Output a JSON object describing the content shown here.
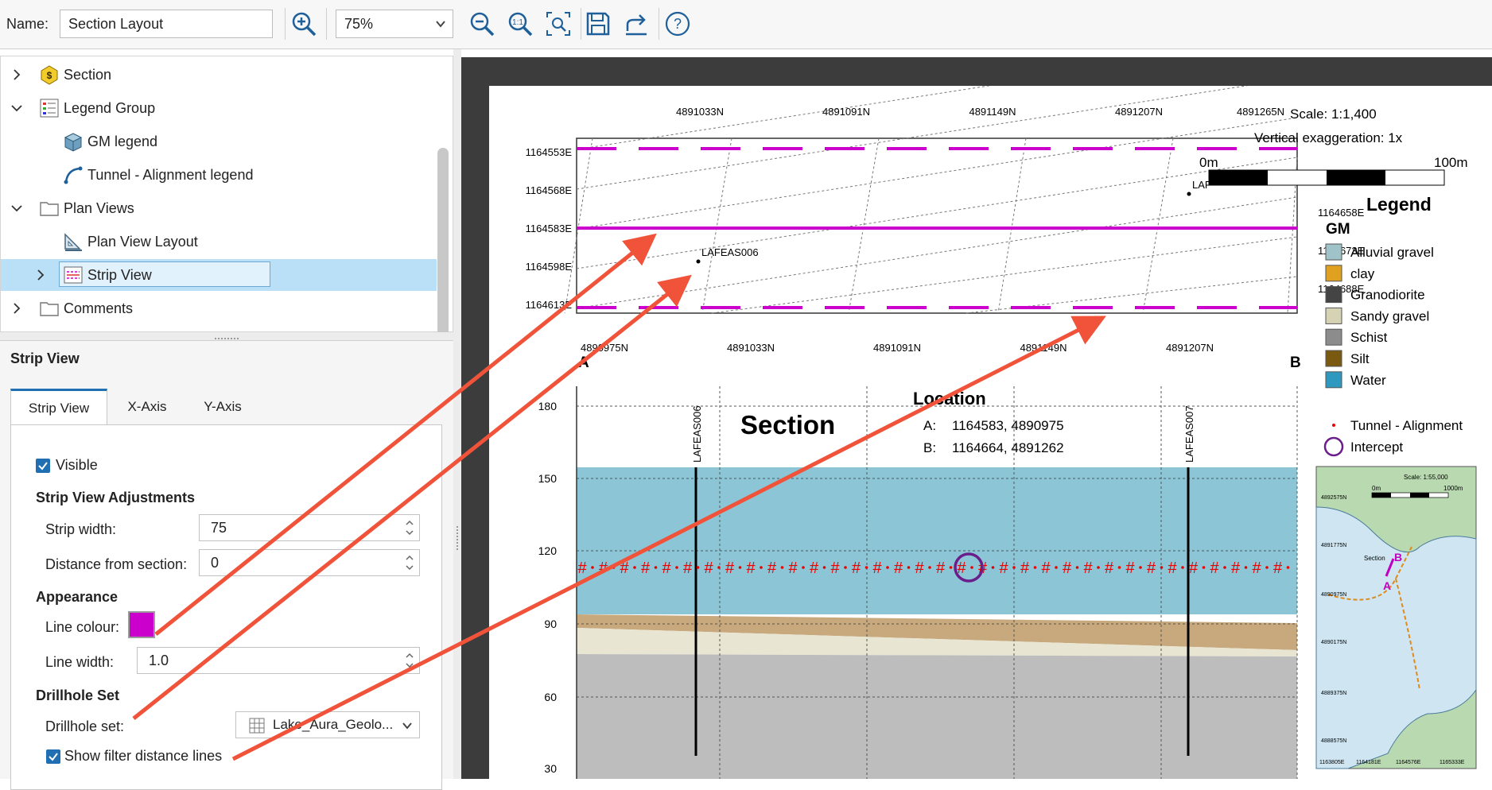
{
  "toolbar": {
    "name_label": "Name:",
    "name_value": "Section Layout",
    "zoom_value": "75%"
  },
  "tree": {
    "items": [
      {
        "label": "Section"
      },
      {
        "label": "Legend Group"
      },
      {
        "label": "GM legend"
      },
      {
        "label": "Tunnel - Alignment legend"
      },
      {
        "label": "Plan Views"
      },
      {
        "label": "Plan View Layout"
      },
      {
        "label": "Strip View"
      },
      {
        "label": "Comments"
      }
    ]
  },
  "props": {
    "title": "Strip View",
    "tabs": [
      "Strip View",
      "X-Axis",
      "Y-Axis"
    ],
    "visible_label": "Visible",
    "adjustments_heading": "Strip View Adjustments",
    "strip_width_label": "Strip width:",
    "strip_width_value": "75",
    "distance_label": "Distance from section:",
    "distance_value": "0",
    "appearance_heading": "Appearance",
    "line_colour_label": "Line colour:",
    "line_colour": "#cc00cc",
    "line_width_label": "Line width:",
    "line_width_value": "1.0",
    "drillhole_heading": "Drillhole Set",
    "drillhole_set_label": "Drillhole set:",
    "drillhole_set_value": "Lake_Aura_Geolo...",
    "filter_lines_label": "Show filter distance lines"
  },
  "layout_sheet": {
    "strip": {
      "top_labels": [
        "4891033N",
        "4891091N",
        "4891149N",
        "4891207N",
        "4891265N"
      ],
      "bottom_labels": [
        "4890975N",
        "4891033N",
        "4891091N",
        "4891149N",
        "4891207N"
      ],
      "left_labels": [
        "1164553E",
        "1164568E",
        "1164583E",
        "1164598E",
        "1164613E"
      ],
      "right_labels": [
        "1164658E",
        "1164673E",
        "1164688E"
      ],
      "drillholes": [
        "LAFEAS006",
        "LAF"
      ]
    },
    "scale_text": "Scale: 1:1,400",
    "vex_text": "Vertical exaggeration: 1x",
    "scalebar_start": "0m",
    "scalebar_end": "100m",
    "legend_title": "Legend",
    "legend_group": "GM",
    "legend_items": [
      {
        "label": "Alluvial gravel",
        "color": "#9fc3c9"
      },
      {
        "label": "clay",
        "color": "#e0a020"
      },
      {
        "label": "Granodiorite",
        "color": "#444444"
      },
      {
        "label": "Sandy gravel",
        "color": "#d6d2b4"
      },
      {
        "label": "Schist",
        "color": "#8c8c8c"
      },
      {
        "label": "Silt",
        "color": "#7a5a10"
      },
      {
        "label": "Water",
        "color": "#2e98bf"
      }
    ],
    "tunnel_label": "Tunnel - Alignment",
    "intercept_label": "Intercept",
    "section_title": "Section",
    "end_a": "A",
    "end_b": "B",
    "location_title": "Location",
    "loc_a_key": "A:",
    "loc_a_value": "1164583, 4890975",
    "loc_b_key": "B:",
    "loc_b_value": "1164664, 4891262",
    "y_ticks": [
      "180",
      "150",
      "120",
      "90",
      "60",
      "30"
    ],
    "section_drillholes": [
      "LAFEAS006",
      "LAFEAS007"
    ],
    "inset": {
      "scale": "Scale: 1:55,000",
      "bar_start": "0m",
      "bar_end": "1000m",
      "north_labels": [
        "4892575N",
        "4891775N",
        "4890975N",
        "4890175N",
        "4889375N",
        "4888575N"
      ],
      "east_labels": [
        "1163805E",
        "1164181E",
        "1164576E",
        "1165333E"
      ],
      "section_label": "Section",
      "a": "A",
      "b": "B"
    }
  }
}
